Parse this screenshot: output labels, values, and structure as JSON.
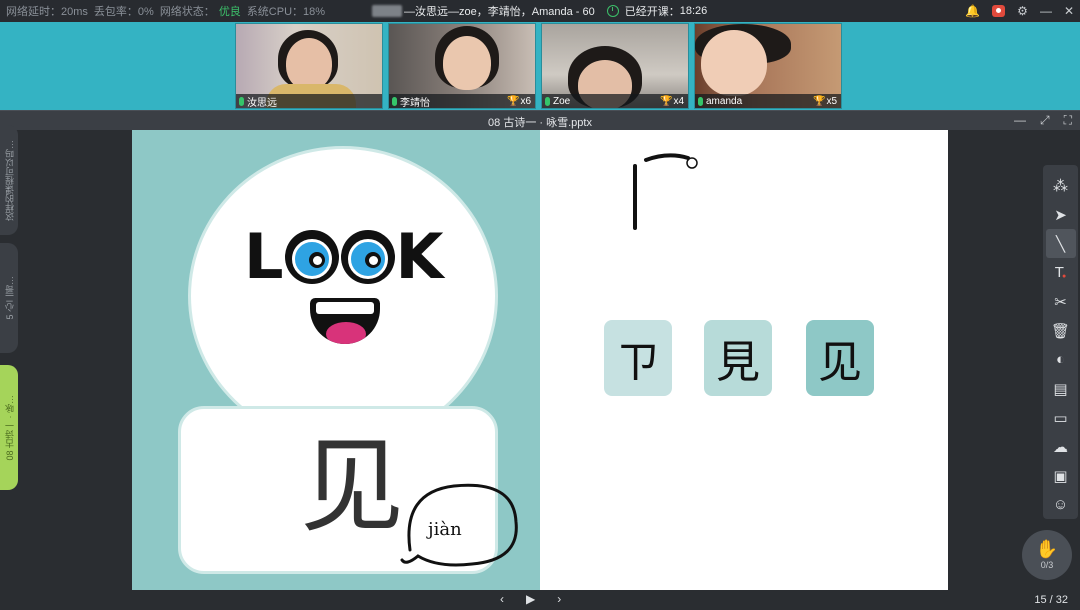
{
  "status": {
    "latency_label": "网络延时：",
    "latency_value": "20ms",
    "loss_label": "丢包率：",
    "loss_value": "0%",
    "net_label": "网络状态：",
    "net_value": "优良",
    "cpu_label": "系统CPU：",
    "cpu_value": "18%",
    "good_color": "#3cc06a"
  },
  "session": {
    "title": "—汝思远—zoe，李靖怡，Amanda - 60",
    "started_label": "已经开课：",
    "started_time": "18:26"
  },
  "window_controls": [
    "bell-icon",
    "record-icon",
    "gear-icon",
    "minimize-icon",
    "close-icon"
  ],
  "participants": [
    {
      "name": "汝思远",
      "trophies": ""
    },
    {
      "name": "李靖怡",
      "trophies": "x6"
    },
    {
      "name": "Zoe",
      "trophies": "x4"
    },
    {
      "name": "amanda",
      "trophies": "x5"
    }
  ],
  "document": {
    "title": "08 古诗一 · 咏雪.pptx"
  },
  "side_tabs": [
    "这样的课程可以吗…",
    "5 心二哥…",
    "08 古诗一 · 咏…"
  ],
  "slide": {
    "look_letters": {
      "first": "L",
      "last": "K"
    },
    "character": "见",
    "pinyin": "jiàn",
    "evolution": [
      "ㄗ",
      "見",
      "见"
    ]
  },
  "toolbar": {
    "tools": [
      {
        "icon": "laser-pointer-icon",
        "glyph": "⁂"
      },
      {
        "icon": "select-move-icon",
        "glyph": "➤"
      },
      {
        "icon": "pen-icon",
        "glyph": "╲"
      },
      {
        "icon": "text-icon",
        "glyph": "T"
      },
      {
        "icon": "scissors-icon",
        "glyph": "✂"
      },
      {
        "icon": "trash-icon",
        "glyph": "🗑"
      },
      {
        "icon": "toggle-icon",
        "glyph": "◐"
      },
      {
        "icon": "whiteboard-icon",
        "glyph": "▤"
      },
      {
        "icon": "chat-icon",
        "glyph": "▭"
      },
      {
        "icon": "cloud-icon",
        "glyph": "☁"
      },
      {
        "icon": "toolbox-icon",
        "glyph": "▣"
      },
      {
        "icon": "students-icon",
        "glyph": "☺"
      }
    ],
    "hand_raise_count": "0/3"
  },
  "nav": {
    "prev": "‹",
    "play": "▶",
    "next": "›",
    "page": "15 / 32"
  }
}
